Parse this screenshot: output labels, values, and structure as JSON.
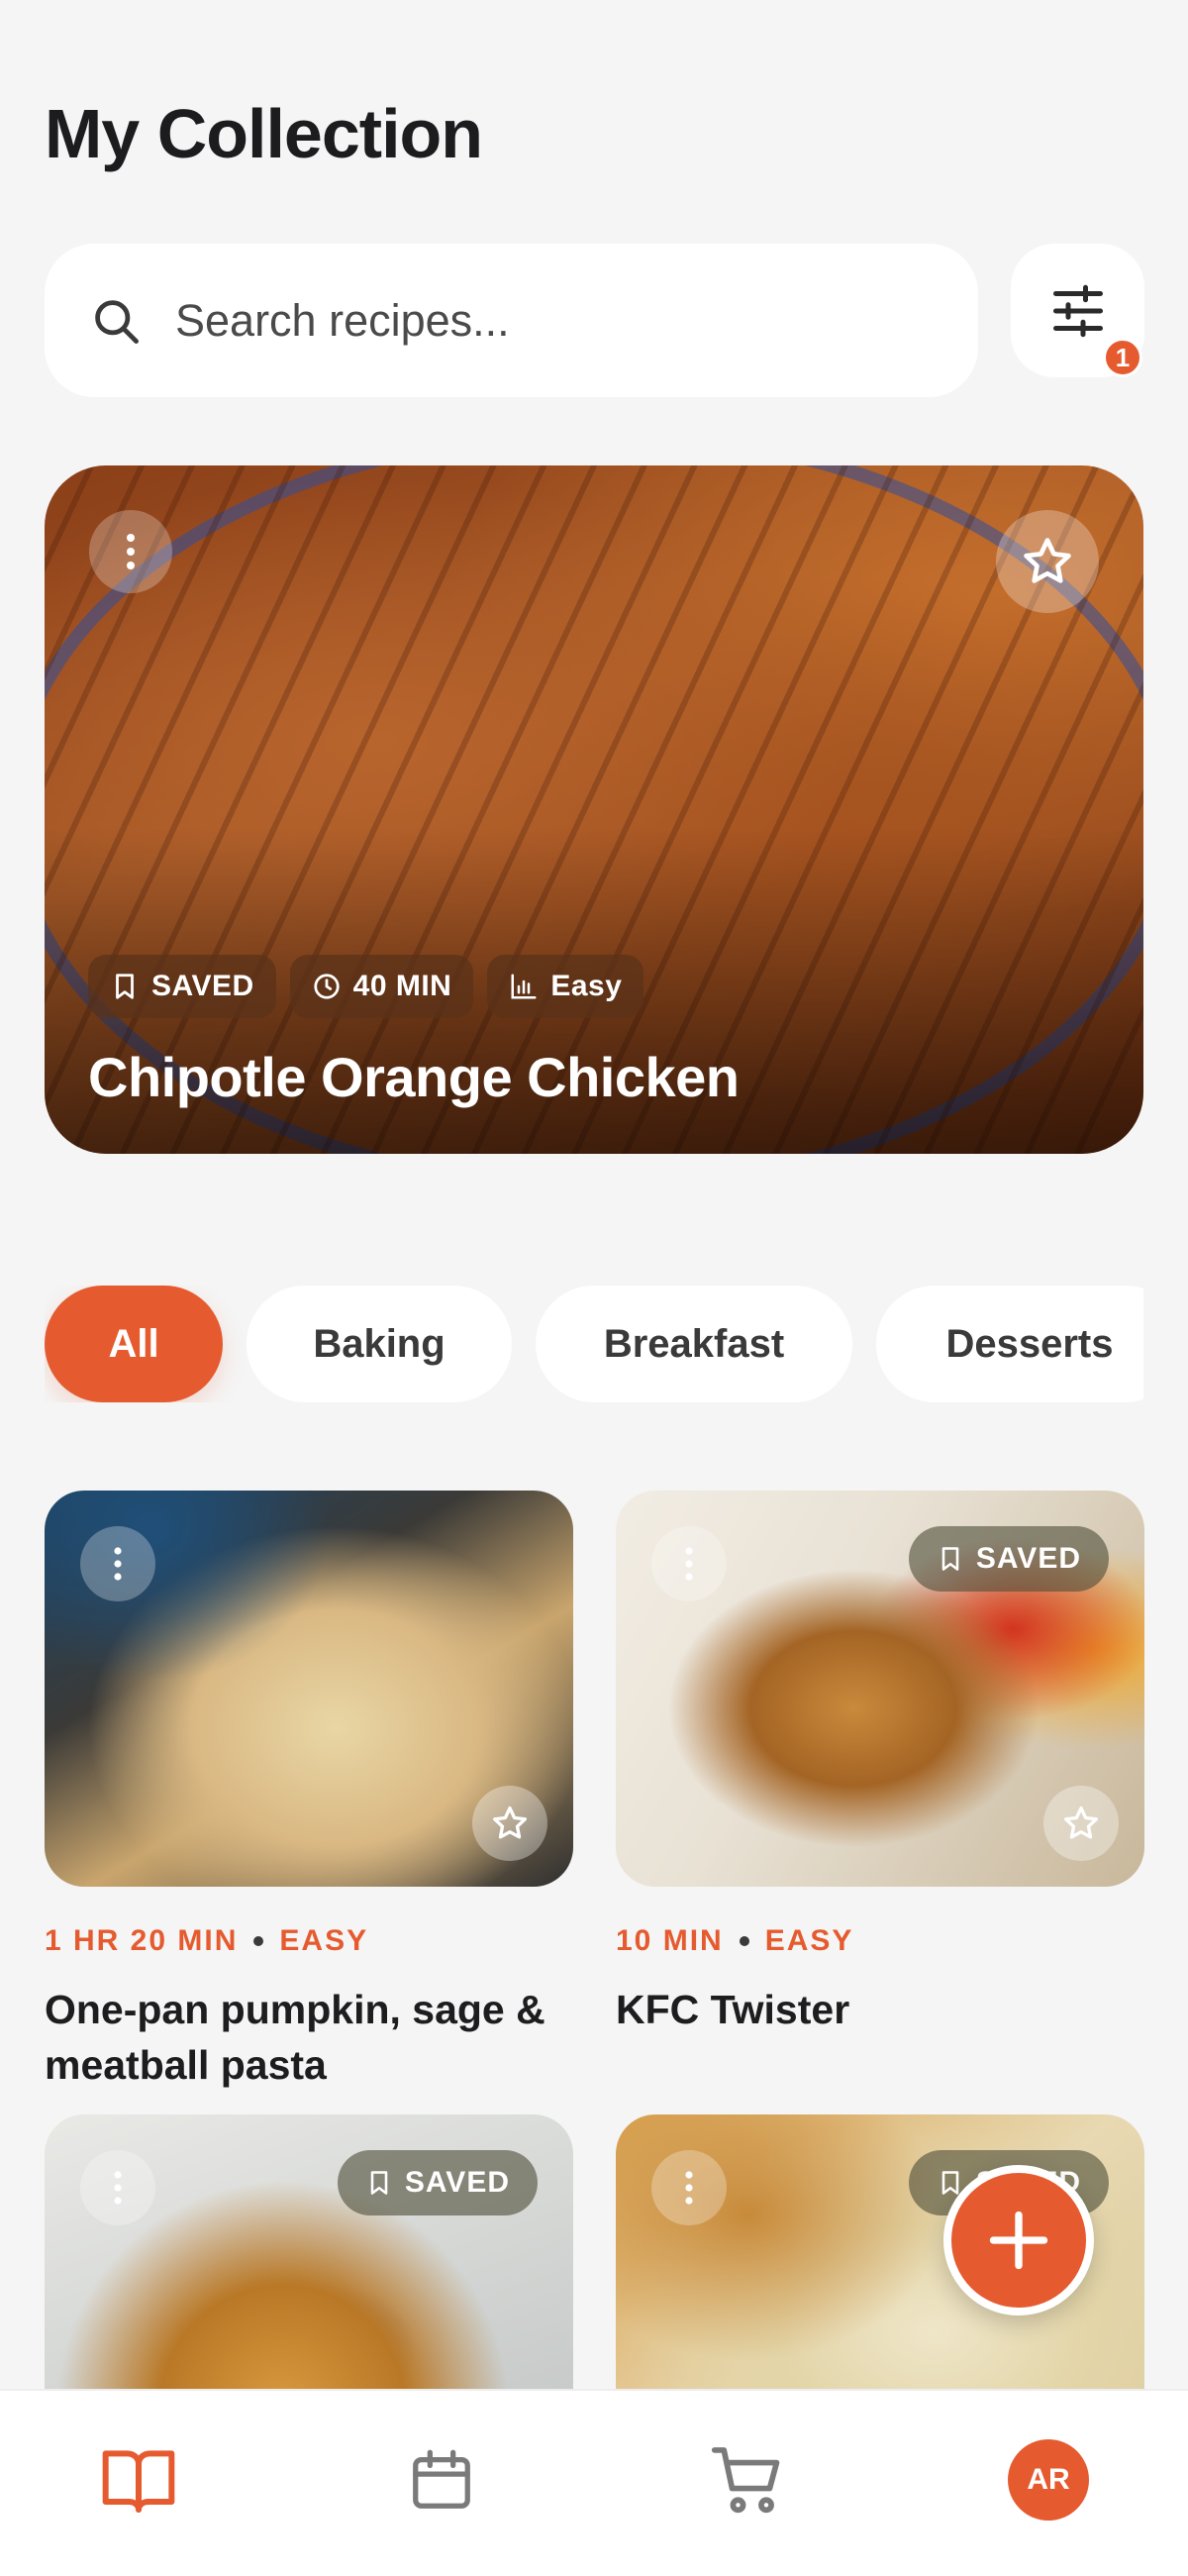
{
  "header": {
    "title": "My Collection"
  },
  "search": {
    "placeholder": "Search recipes..."
  },
  "filter": {
    "badge_count": "1"
  },
  "featured": {
    "title": "Chipotle Orange Chicken",
    "chips": [
      {
        "icon": "bookmark-icon",
        "label": "SAVED"
      },
      {
        "icon": "clock-icon",
        "label": "40 MIN"
      },
      {
        "icon": "bar-chart-icon",
        "label": "Easy"
      }
    ]
  },
  "categories": [
    "All",
    "Baking",
    "Breakfast",
    "Desserts"
  ],
  "recipes": [
    {
      "time": "1 HR 20 MIN",
      "difficulty": "EASY",
      "name": "One-pan pumpkin, sage & meatball pasta",
      "saved": false
    },
    {
      "time": "10 MIN",
      "difficulty": "EASY",
      "name": "KFC Twister",
      "saved": true,
      "saved_label": "SAVED"
    },
    {
      "saved": true,
      "saved_label": "SAVED"
    },
    {
      "saved": true,
      "saved_label": "SAVED"
    }
  ],
  "nav": {
    "avatar_initials": "AR"
  },
  "colors": {
    "accent": "#e55b2f",
    "background": "#f5f5f5",
    "surface": "#ffffff"
  }
}
